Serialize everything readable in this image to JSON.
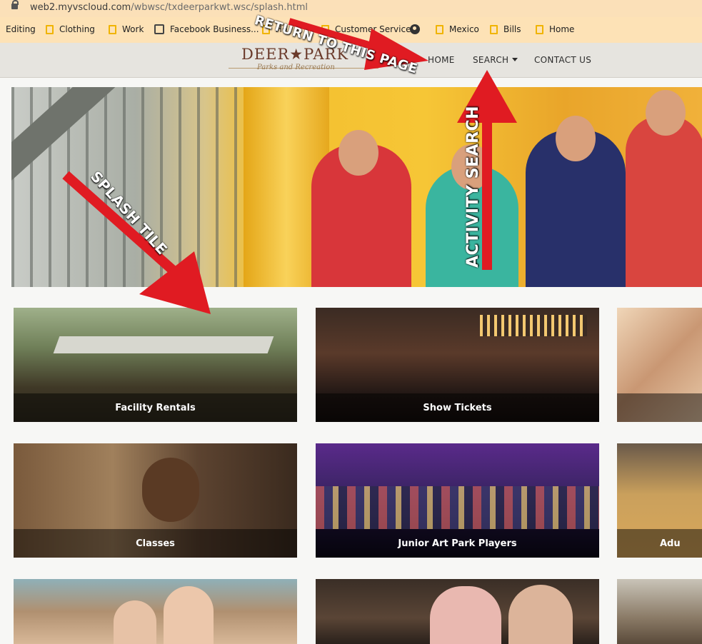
{
  "browser": {
    "url_host": "web2.myvscloud.com",
    "url_path": "/wbwsc/txdeerparkwt.wsc/splash.html"
  },
  "bookmarks": [
    {
      "label": "Editing",
      "icon": "none"
    },
    {
      "label": "Clothing",
      "icon": "folder-icon"
    },
    {
      "label": "Work",
      "icon": "folder-icon"
    },
    {
      "label": "Facebook Business...",
      "icon": "facebook-business-icon"
    },
    {
      "label": "Ho",
      "icon": "folder-icon"
    },
    {
      "label": "Customer Service",
      "icon": "folder-icon"
    },
    {
      "label": "",
      "icon": "globe-icon"
    },
    {
      "label": "Mexico",
      "icon": "folder-icon"
    },
    {
      "label": "Bills",
      "icon": "folder-icon"
    },
    {
      "label": "Home",
      "icon": "folder-icon"
    }
  ],
  "site": {
    "logo_name": "DEER★PARK",
    "logo_tagline": "Parks and Recreation",
    "nav": {
      "home": "HOME",
      "search": "SEARCH",
      "contact": "CONTACT US"
    }
  },
  "tiles": [
    {
      "label": "Facility Rentals"
    },
    {
      "label": "Show Tickets"
    },
    {
      "label": ""
    },
    {
      "label": "Classes"
    },
    {
      "label": "Junior Art Park Players"
    },
    {
      "label": "Adu"
    },
    {
      "label": ""
    },
    {
      "label": ""
    },
    {
      "label": ""
    }
  ],
  "annotations": {
    "return": "RETURN TO THIS PAGE",
    "activity": "ACTIVITY SEARCH",
    "splash": "SPLASH TILE"
  },
  "colors": {
    "arrow": "#e01b22",
    "header_bg": "#e6e4df",
    "bookmarks_bg": "#fde2b6",
    "logo_brown": "#6a3a2a"
  }
}
